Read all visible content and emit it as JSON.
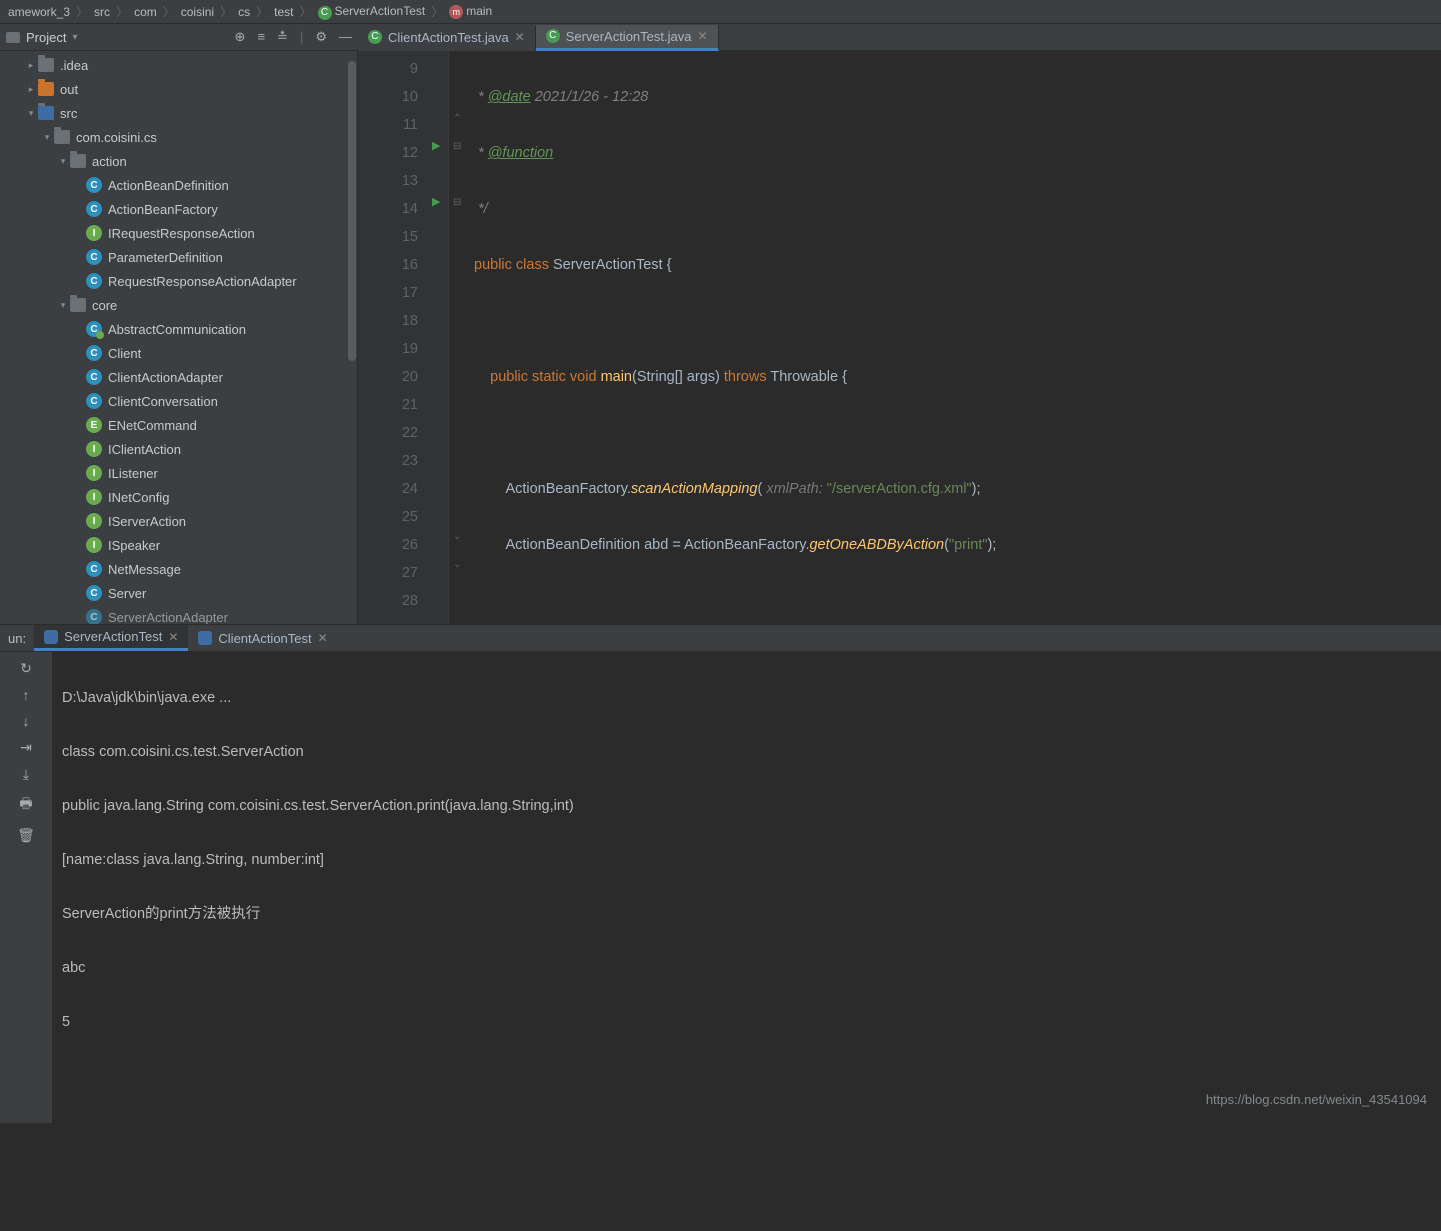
{
  "breadcrumbs": [
    "amework_3",
    "src",
    "com",
    "coisini",
    "cs",
    "test",
    "ServerActionTest",
    "main"
  ],
  "project_label": "Project",
  "tabs": [
    {
      "label": "ClientActionTest.java",
      "active": false
    },
    {
      "label": "ServerActionTest.java",
      "active": true
    }
  ],
  "tree": {
    "idea": ".idea",
    "out": "out",
    "src": "src",
    "pkg": "com.coisini.cs",
    "action": "action",
    "action_items": [
      {
        "t": "c",
        "l": "ActionBeanDefinition"
      },
      {
        "t": "c",
        "l": "ActionBeanFactory"
      },
      {
        "t": "i",
        "l": "IRequestResponseAction"
      },
      {
        "t": "c",
        "l": "ParameterDefinition"
      },
      {
        "t": "c",
        "l": "RequestResponseActionAdapter"
      }
    ],
    "core": "core",
    "core_items": [
      {
        "t": "ic",
        "l": "AbstractCommunication"
      },
      {
        "t": "c",
        "l": "Client"
      },
      {
        "t": "c",
        "l": "ClientActionAdapter"
      },
      {
        "t": "c",
        "l": "ClientConversation"
      },
      {
        "t": "e",
        "l": "ENetCommand"
      },
      {
        "t": "i",
        "l": "IClientAction"
      },
      {
        "t": "i",
        "l": "IListener"
      },
      {
        "t": "i",
        "l": "INetConfig"
      },
      {
        "t": "i",
        "l": "IServerAction"
      },
      {
        "t": "i",
        "l": "ISpeaker"
      },
      {
        "t": "c",
        "l": "NetMessage"
      },
      {
        "t": "c",
        "l": "Server"
      },
      {
        "t": "c",
        "l": "ServerActionAdapter"
      }
    ]
  },
  "code": {
    "line_start": 9,
    "date_tag": "@date",
    "date_val": "2021/1/26 - 12:28",
    "fn_tag": "@function",
    "classname": "ServerActionTest",
    "xml_hint": "xmlPath:",
    "xml_path": "\"/serverAction.cfg.xml\"",
    "print_arg": "\"print\""
  },
  "run": {
    "label": "un:",
    "tabs": [
      {
        "l": "ServerActionTest",
        "active": true
      },
      {
        "l": "ClientActionTest",
        "active": false
      }
    ],
    "lines": [
      "D:\\Java\\jdk\\bin\\java.exe ...",
      "class com.coisini.cs.test.ServerAction",
      "public java.lang.String com.coisini.cs.test.ServerAction.print(java.lang.String,int)",
      "[name:class java.lang.String, number:int]",
      "ServerAction的print方法被执行",
      "abc",
      "5"
    ]
  },
  "watermark": "https://blog.csdn.net/weixin_43541094"
}
